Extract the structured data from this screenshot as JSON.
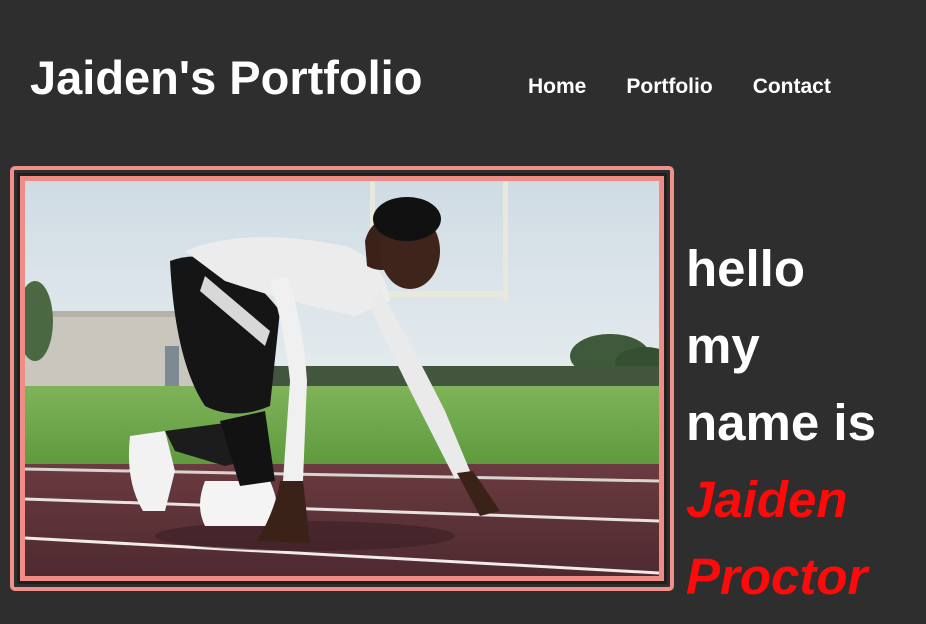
{
  "header": {
    "title": "Jaiden's Portfolio",
    "nav": [
      {
        "label": "Home"
      },
      {
        "label": "Portfolio"
      },
      {
        "label": "Contact"
      }
    ]
  },
  "hero": {
    "image_subject": "sprinter-in-starting-position",
    "greeting_lines": [
      "hello",
      "my",
      "name is"
    ],
    "name_lines": [
      "Jaiden",
      "Proctor"
    ]
  },
  "colors": {
    "background": "#2e2e2e",
    "frame_border": "#f0908a",
    "name_accent": "#ff0a0a",
    "text": "#ffffff"
  }
}
